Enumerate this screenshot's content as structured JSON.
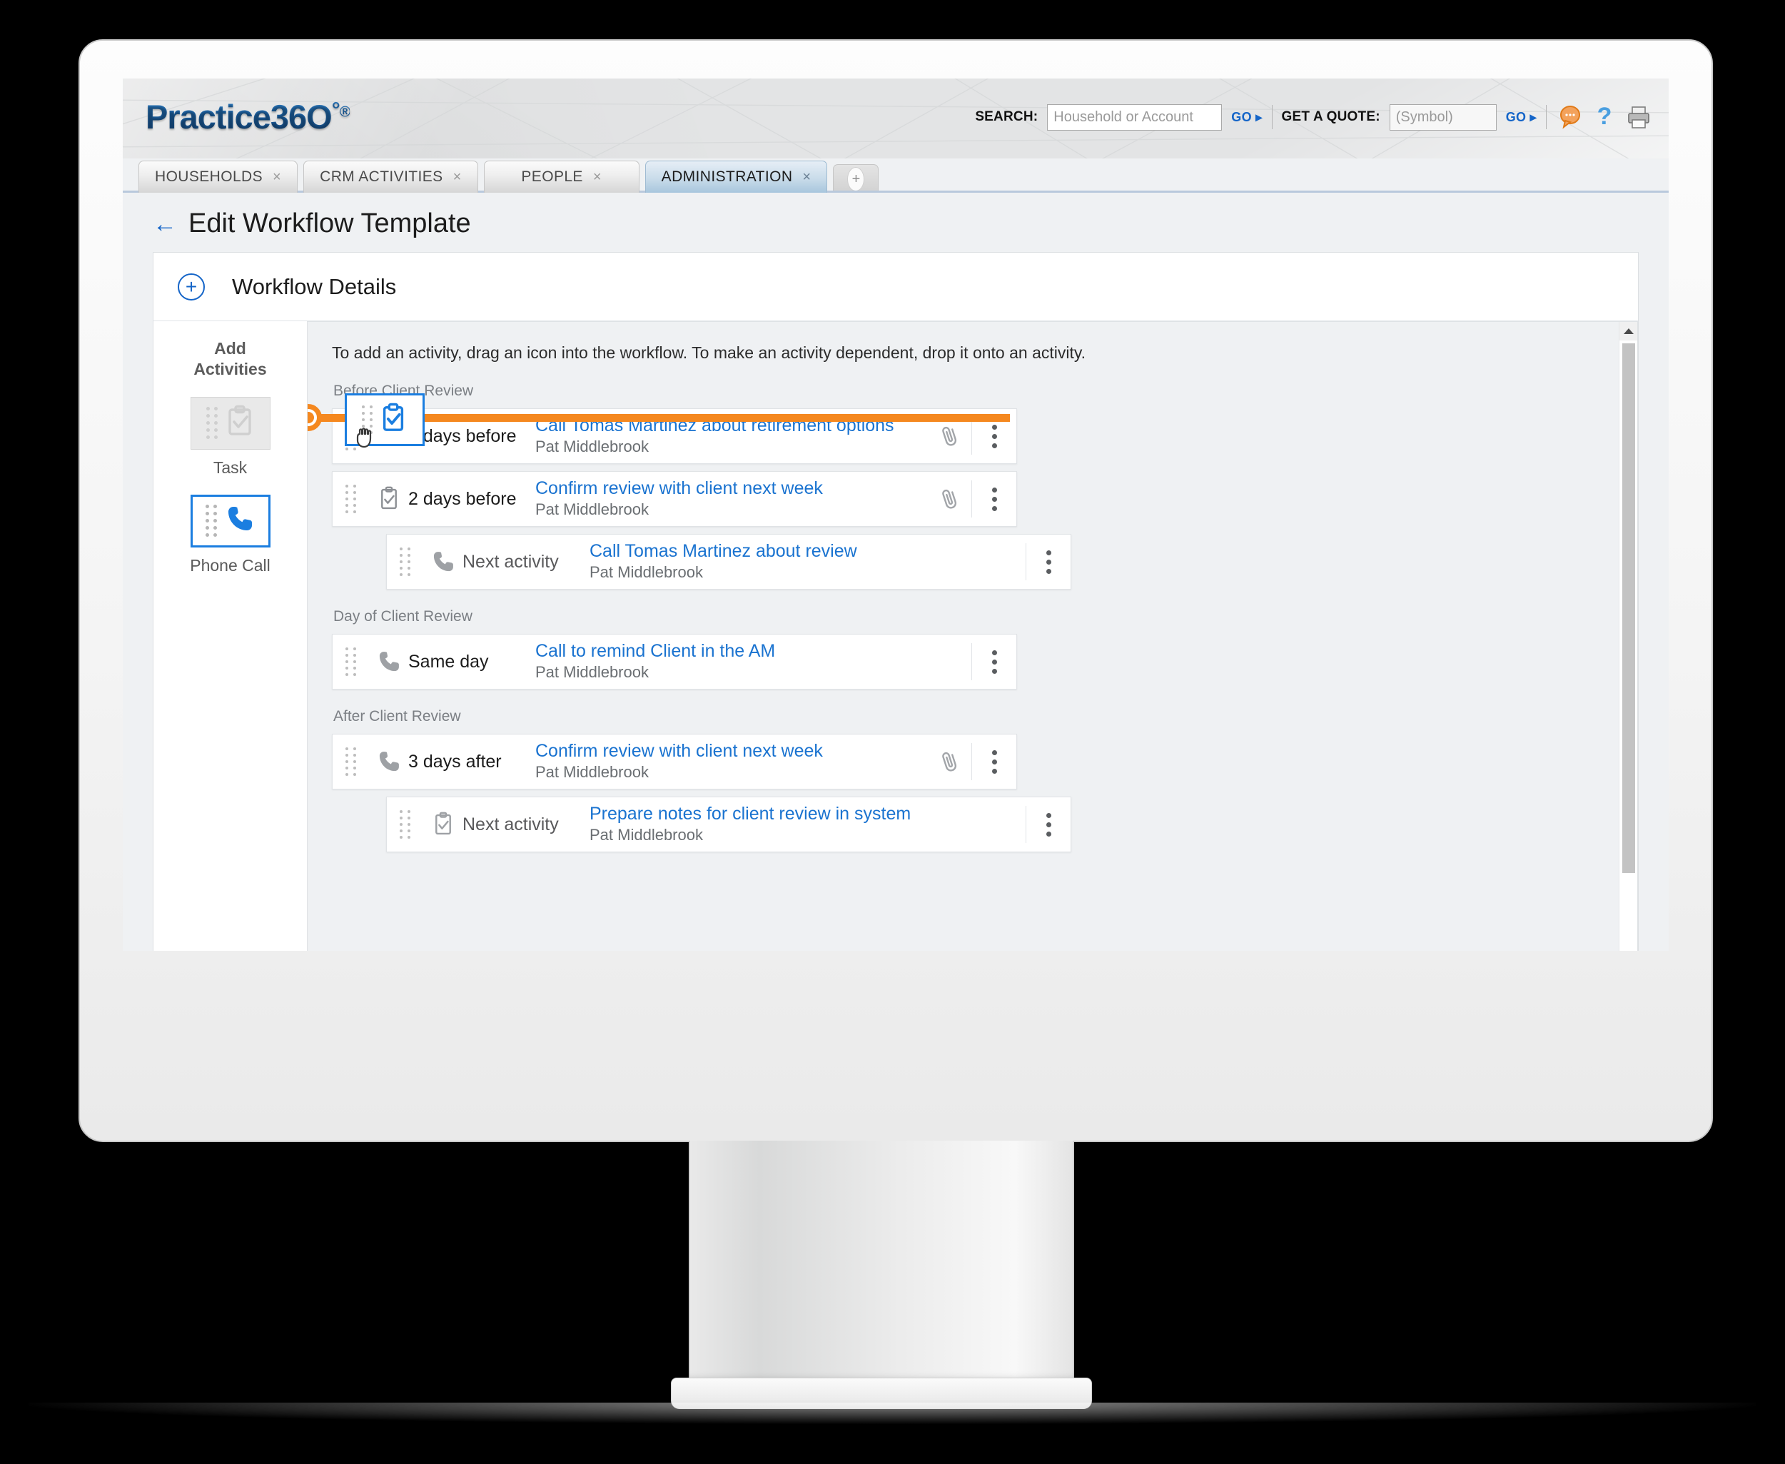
{
  "header": {
    "logo_text": "Practice36O",
    "logo_degree": "°",
    "logo_registered": "®",
    "search_label": "SEARCH:",
    "search_placeholder": "Household or Account",
    "search_value": "",
    "search_go": "GO",
    "quote_label": "GET A QUOTE:",
    "quote_placeholder": "(Symbol)",
    "quote_value": "",
    "quote_go": "GO",
    "chat_icon": "chat-bubble-icon",
    "help_icon": "question-mark-icon",
    "print_icon": "printer-icon",
    "accent_blue": "#1565c8"
  },
  "tabs": {
    "items": [
      {
        "label": "HOUSEHOLDS",
        "close": "×",
        "active": false
      },
      {
        "label": "CRM ACTIVITIES",
        "close": "×",
        "active": false
      },
      {
        "label": "PEOPLE",
        "close": "×",
        "active": false
      },
      {
        "label": "ADMINISTRATION",
        "close": "×",
        "active": true
      }
    ],
    "add_label": "+"
  },
  "page": {
    "back_arrow": "←",
    "title": "Edit Workflow Template"
  },
  "workflow_details": {
    "expand_icon": "+",
    "title": "Workflow Details"
  },
  "palette": {
    "title_line1": "Add",
    "title_line2": "Activities",
    "items": [
      {
        "label": "Task",
        "icon": "clipboard-check-icon",
        "state": "disabled"
      },
      {
        "label": "Phone Call",
        "icon": "phone-icon",
        "state": "selected"
      }
    ]
  },
  "canvas": {
    "instructions": "To add an activity, drag an icon into the workflow. To make an activity dependent, drop it onto an activity.",
    "drop_indicator": {
      "color": "#f5881f",
      "position": "between-row-1-and-row-2"
    },
    "drag_ghost": {
      "icon": "clipboard-check-icon",
      "cursor": "grabbing-hand-cursor",
      "color": "#1b7ee0"
    },
    "sections": [
      {
        "label": "Before Client Review",
        "rows": [
          {
            "level": "parent",
            "icon": "phone-icon",
            "timing": "3 days before",
            "title": "Call Tomas Martinez about retirement options",
            "owner": "Pat Middlebrook",
            "has_attachment": true,
            "has_menu": true
          },
          {
            "level": "parent",
            "icon": "clipboard-check-icon",
            "timing": "2 days before",
            "title": "Confirm review with client next week",
            "owner": "Pat Middlebrook",
            "has_attachment": true,
            "has_menu": true
          },
          {
            "level": "child",
            "icon": "phone-icon",
            "timing": "Next activity",
            "title": "Call Tomas Martinez about review",
            "owner": "Pat Middlebrook",
            "has_attachment": false,
            "has_menu": true
          }
        ]
      },
      {
        "label": "Day of Client Review",
        "rows": [
          {
            "level": "parent",
            "icon": "phone-icon",
            "timing": "Same day",
            "title": "Call to remind Client in the AM",
            "owner": "Pat Middlebrook",
            "has_attachment": false,
            "has_menu": true
          }
        ]
      },
      {
        "label": "After Client Review",
        "rows": [
          {
            "level": "parent",
            "icon": "phone-icon",
            "timing": "3 days after",
            "title": "Confirm review with client next week",
            "owner": "Pat Middlebrook",
            "has_attachment": true,
            "has_menu": true
          },
          {
            "level": "child",
            "icon": "clipboard-check-icon",
            "timing": "Next activity",
            "title": "Prepare notes for client review in system",
            "owner": "Pat Middlebrook",
            "has_attachment": false,
            "has_menu": true
          }
        ]
      }
    ]
  },
  "scrollbar": {
    "up_arrow": "▲"
  }
}
